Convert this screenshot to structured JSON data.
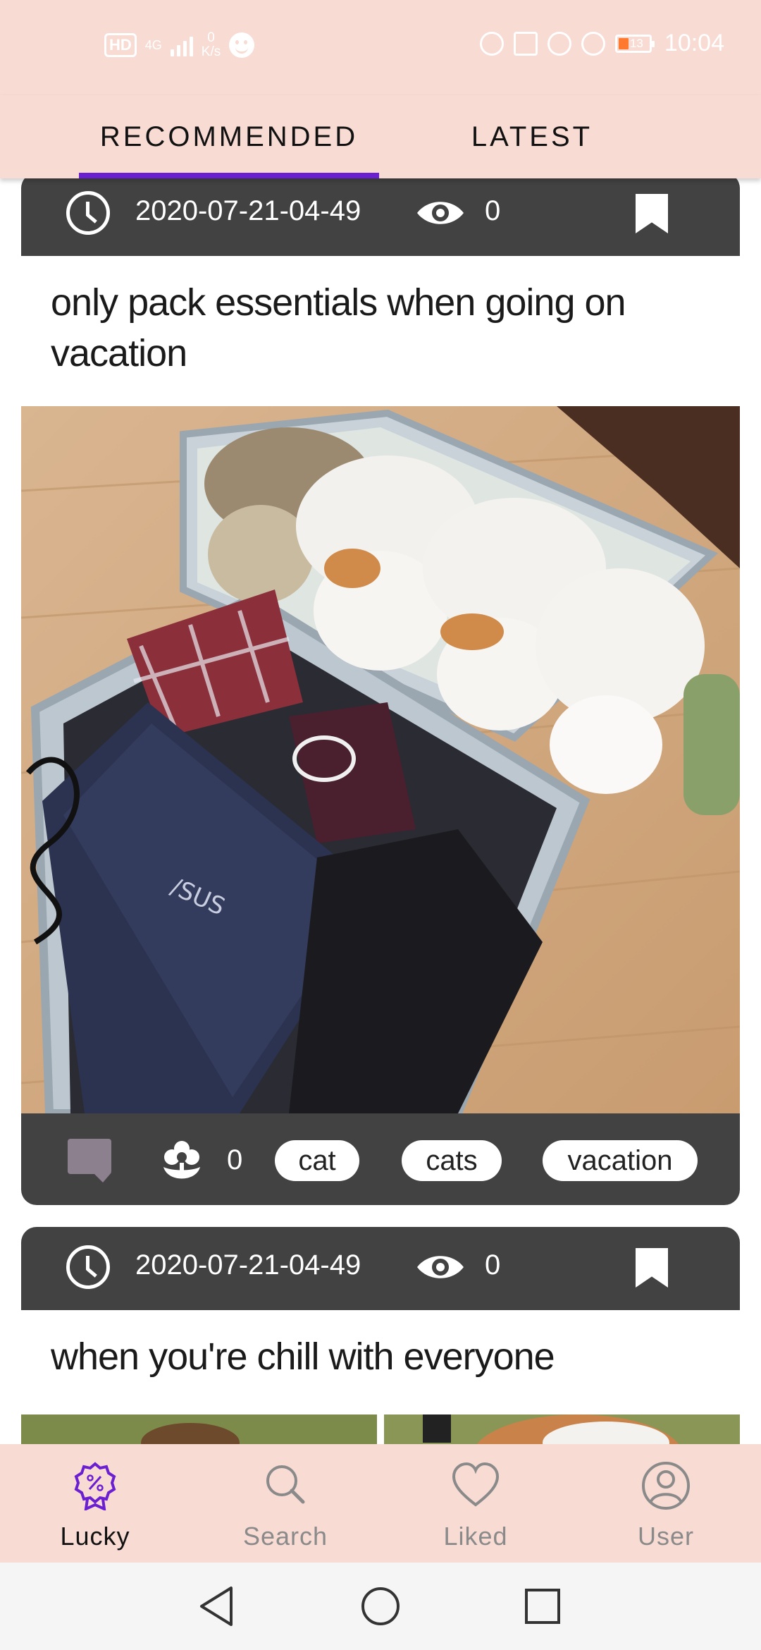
{
  "status_bar": {
    "hd": "HD",
    "network": "4G",
    "speed_value": "0",
    "speed_unit": "K/s",
    "battery": "13",
    "time": "10:04"
  },
  "tabs": [
    {
      "label": "RECOMMENDED",
      "active": true
    },
    {
      "label": "LATEST",
      "active": false
    }
  ],
  "posts": [
    {
      "date": "2020-07-21-04-49",
      "views": "0",
      "title": "only pack essentials when going on vacation",
      "likes": "0",
      "tags": [
        "cat",
        "cats",
        "vacation"
      ],
      "image": "photo of cats lying inside an open suitcase with a laptop and clothes"
    },
    {
      "date": "2020-07-21-04-49",
      "views": "0",
      "title": "when you're chill with everyone",
      "image": "photo of capybaras on grass"
    }
  ],
  "bottom_nav": [
    {
      "label": "Lucky",
      "icon": "badge-percent-icon",
      "active": true
    },
    {
      "label": "Search",
      "icon": "search-icon",
      "active": false
    },
    {
      "label": "Liked",
      "icon": "heart-icon",
      "active": false
    },
    {
      "label": "User",
      "icon": "user-icon",
      "active": false
    }
  ],
  "colors": {
    "accent": "#6a1fd1",
    "bar_background": "#f8dbd3",
    "card_header": "#424242"
  }
}
